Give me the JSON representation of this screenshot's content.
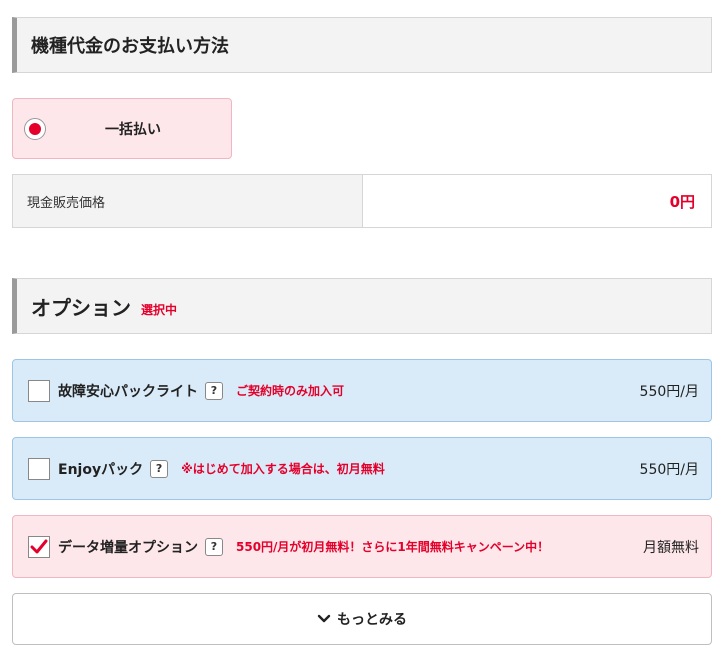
{
  "colors": {
    "accent": "#e4002b",
    "radio": "#e4002b",
    "check": "#e4002b"
  },
  "payment": {
    "title": "機種代金のお支払い方法",
    "option_label": "一括払い",
    "price_label": "現金販売価格",
    "price_value": "0円"
  },
  "options": {
    "title": "オプション",
    "status": "選択中",
    "items": [
      {
        "name": "故障安心パックライト",
        "help": "?",
        "note": "ご契約時のみ加入可",
        "price": "550円/月",
        "checked": false
      },
      {
        "name": "Enjoyパック",
        "help": "?",
        "note": "※はじめて加入する場合は、初月無料",
        "price": "550円/月",
        "checked": false
      },
      {
        "name": "データ増量オプション",
        "help": "?",
        "note": "550円/月が初月無料！さらに1年間無料キャンペーン中！",
        "price": "月額無料",
        "checked": true
      }
    ]
  },
  "more": {
    "label": "もっとみる",
    "icon": "chevron-down-icon"
  }
}
